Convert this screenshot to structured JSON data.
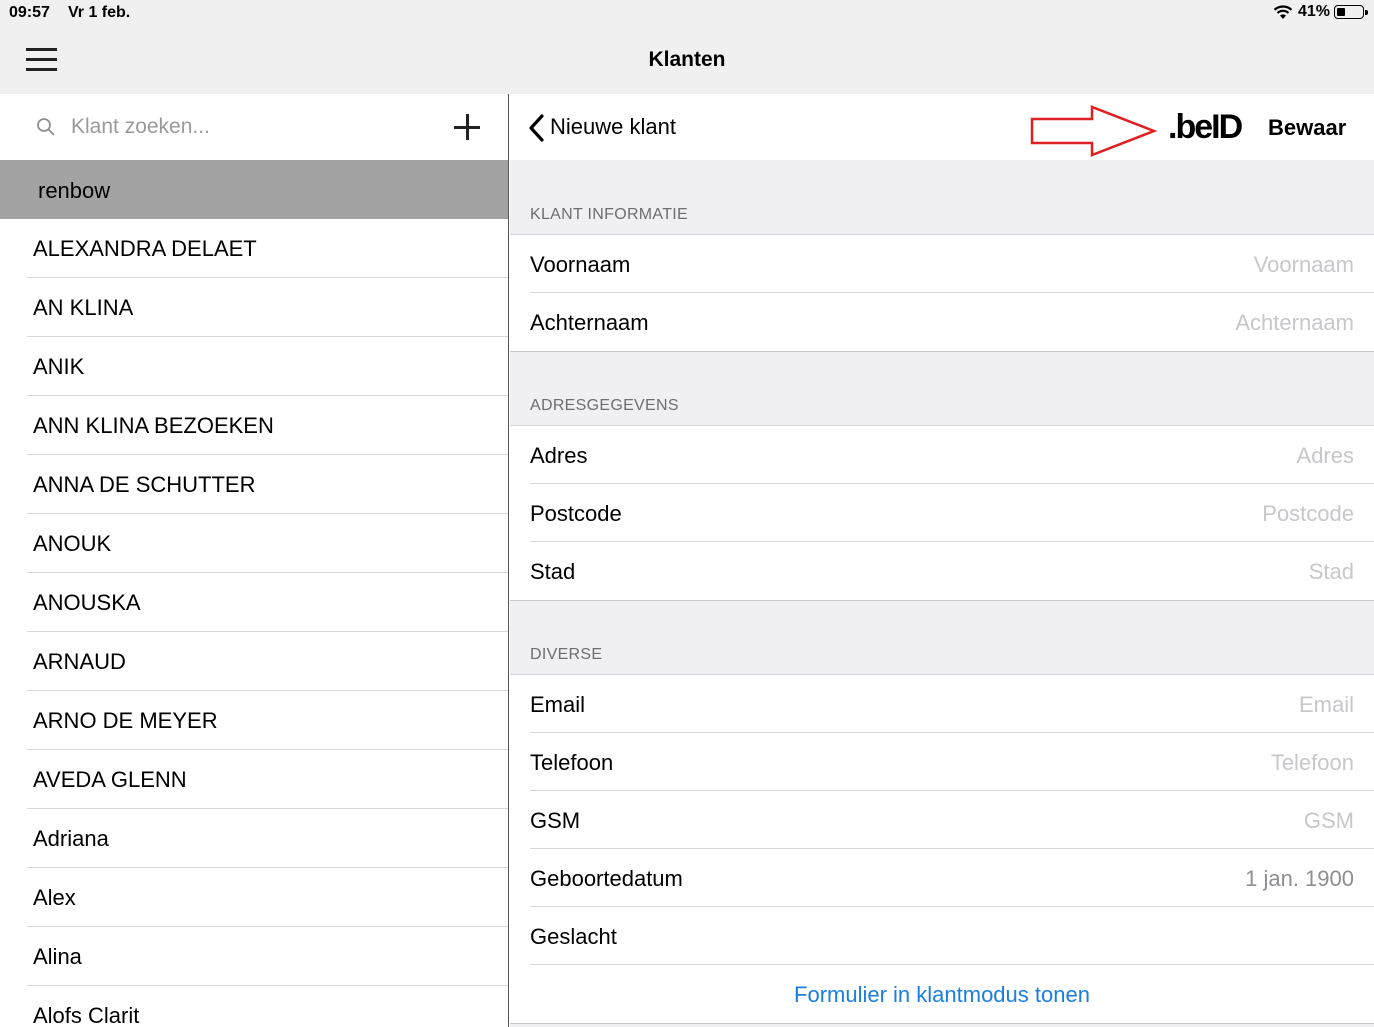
{
  "status": {
    "time": "09:57",
    "date": "Vr 1 feb.",
    "battery": "41%",
    "battery_level": 0.41
  },
  "nav": {
    "title": "Klanten"
  },
  "search": {
    "placeholder": "Klant zoeken..."
  },
  "customers": {
    "selected": "renbow",
    "items": [
      "ALEXANDRA DELAET",
      "AN KLINA",
      "ANIK",
      "ANN KLINA BEZOEKEN",
      "ANNA DE SCHUTTER",
      "ANOUK",
      "ANOUSKA",
      "ARNAUD",
      "ARNO DE MEYER",
      "AVEDA GLENN",
      "Adriana",
      "Alex",
      "Alina",
      "Alofs Clarit"
    ]
  },
  "detail": {
    "back_label": "Nieuwe klant",
    "beid_label": ".beID",
    "save_label": "Bewaar",
    "arrow_color": "#e02020",
    "link_color": "#1a7fe0",
    "sections": {
      "info": {
        "header": "KLANT INFORMATIE",
        "rows": [
          {
            "label": "Voornaam",
            "value": "Voornaam"
          },
          {
            "label": "Achternaam",
            "value": "Achternaam"
          }
        ]
      },
      "address": {
        "header": "ADRESGEGEVENS",
        "rows": [
          {
            "label": "Adres",
            "value": "Adres"
          },
          {
            "label": "Postcode",
            "value": "Postcode"
          },
          {
            "label": "Stad",
            "value": "Stad"
          }
        ]
      },
      "misc": {
        "header": "DIVERSE",
        "rows": [
          {
            "label": "Email",
            "value": "Email"
          },
          {
            "label": "Telefoon",
            "value": "Telefoon"
          },
          {
            "label": "GSM",
            "value": "GSM"
          },
          {
            "label": "Geboortedatum",
            "value": "1 jan. 1900"
          },
          {
            "label": "Geslacht",
            "value": ""
          }
        ],
        "link": "Formulier in klantmodus tonen"
      }
    }
  }
}
